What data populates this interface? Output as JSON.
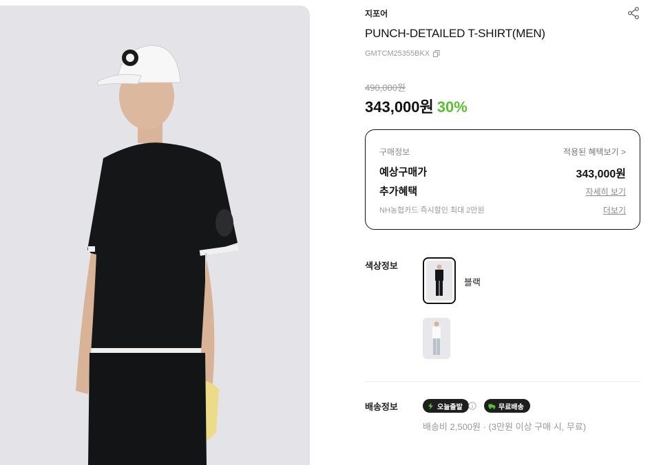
{
  "product": {
    "brand": "지포어",
    "title": "PUNCH-DETAILED T-SHIRT(MEN)",
    "sku": "GMTCM25355BKX",
    "original_price": "490,000원",
    "sale_price": "343,000원",
    "discount": "30%"
  },
  "purchase_info": {
    "header": "구매정보",
    "benefits_link": "적용된 혜택보기 >",
    "expected_label": "예상구매가",
    "expected_value": "343,000원",
    "extra_label": "추가혜택",
    "extra_link": "자세히 보기",
    "card_text": "NH농협카드 즉시할인 최대 2만원",
    "card_link": "더보기"
  },
  "color_info": {
    "label": "색상정보",
    "selected_name": "블랙"
  },
  "shipping": {
    "label": "배송정보",
    "badge_today": "오늘출발",
    "badge_free": "무료배송",
    "fee_text": "배송비 2,500원 · (3만원 이상 구매 시, 무료)"
  },
  "colors": {
    "accent": "#58c22e",
    "text": "#111111",
    "muted": "#9a9a9a",
    "badge_bg": "#1e1e1e"
  },
  "icons": {
    "share": "share-icon",
    "copy": "copy-icon",
    "info": "info-icon",
    "bolt": "bolt-icon",
    "truck": "truck-icon"
  }
}
